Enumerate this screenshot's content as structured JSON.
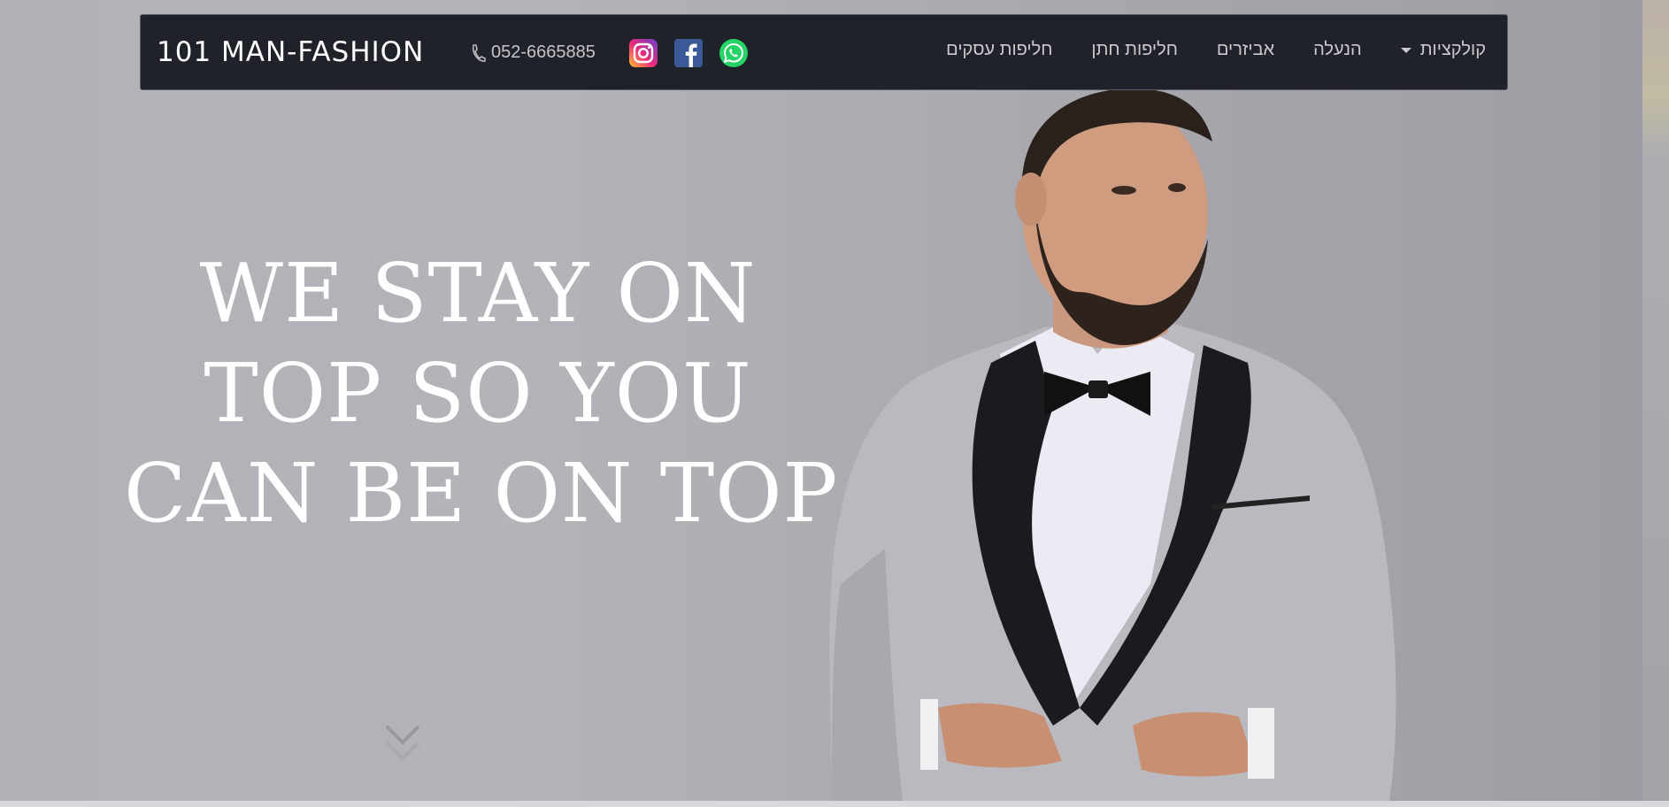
{
  "brand": {
    "name": "101 MAN-FASHION"
  },
  "contact": {
    "phone": "052-6665885",
    "phone_icon": "phone-icon"
  },
  "social": [
    {
      "name": "instagram-icon",
      "color": "#e1306c"
    },
    {
      "name": "facebook-icon",
      "color": "#3b5998"
    },
    {
      "name": "whatsapp-icon",
      "color": "#25d366"
    }
  ],
  "nav": {
    "items": [
      {
        "label": "חליפות עסקים"
      },
      {
        "label": "חליפות חתן"
      },
      {
        "label": "אביזרים"
      },
      {
        "label": "הנעלה"
      },
      {
        "label": "קולקציות",
        "has_dropdown": true
      }
    ]
  },
  "hero": {
    "headline_lines": [
      "WE STAY ON",
      "TOP SO YOU",
      "CAN BE ON TOP"
    ],
    "scroll_icon": "chevron-double-down-icon"
  },
  "colors": {
    "navbar_bg": "#1f2329",
    "nav_text": "#c9cbcf",
    "headline": "#ffffff"
  }
}
